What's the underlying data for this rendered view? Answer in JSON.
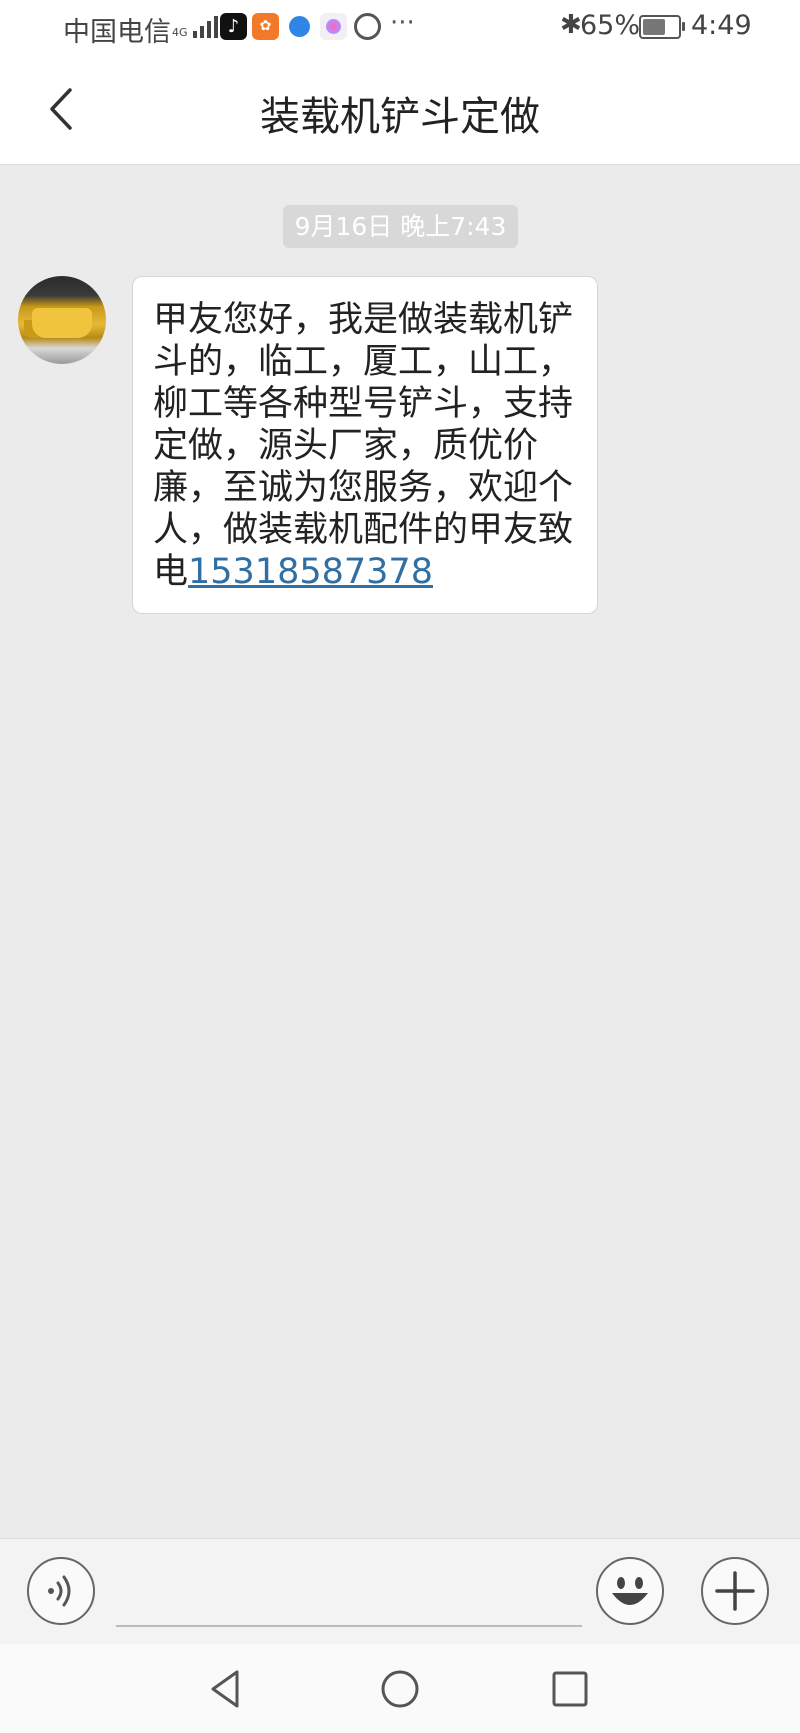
{
  "status_bar": {
    "carrier": "中国电信",
    "network": "4G",
    "battery": "65%",
    "battery_level": 0.65,
    "time": "4:49",
    "more": "···",
    "notification_icons": [
      "tiktok-icon",
      "uc-browser-icon",
      "browser-icon",
      "gallery-icon",
      "hand-icon"
    ]
  },
  "header": {
    "title": "装载机铲斗定做",
    "back_icon": "chevron-left-icon"
  },
  "conversation": {
    "date": "9月16日 晚上7:43",
    "message": {
      "text": "甲友您好，我是做装载机铲斗的，临工，厦工，山工，柳工等各种型号铲斗，支持定做，源头厂家，质优价廉，至诚为您服务，欢迎个人，做装载机配件的甲友致电",
      "phone": "15318587378",
      "link_color": "#2f6fa3"
    }
  },
  "input_bar": {
    "placeholder": "",
    "voice_icon": "voice-icon",
    "emoji_icon": "emoji-icon",
    "plus_icon": "plus-icon"
  },
  "nav_bar": {
    "icons": [
      "back-triangle-icon",
      "home-circle-icon",
      "recent-square-icon"
    ]
  },
  "colors": {
    "background": "#ebebeb",
    "header_bg": "#ffffff",
    "bubble_bg": "#ffffff",
    "date_chip_bg": "#d8d8d8"
  }
}
